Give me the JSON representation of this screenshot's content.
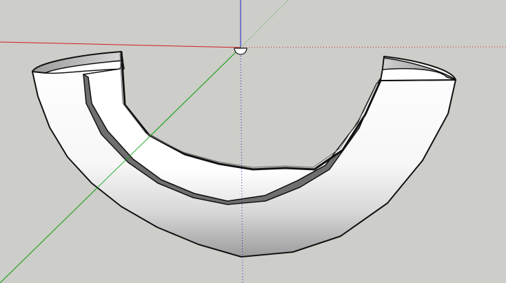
{
  "app": {
    "viewport": {
      "label": "",
      "background_color": "#cdcdc9"
    },
    "axes": {
      "red_axis_color": "#d11f1f",
      "green_axis_color": "#1aa31a",
      "blue_axis_color": "#1f1fd1",
      "red_dotted_color": "#d11f1f",
      "green_dotted_color": "#1aa31a",
      "blue_dotted_color": "#1f1fd1"
    },
    "model": {
      "name": "",
      "type": "half-torus pipe",
      "fill_color": "#ffffff",
      "edge_color": "#111111",
      "shade_color": "#8f8f8f"
    }
  }
}
